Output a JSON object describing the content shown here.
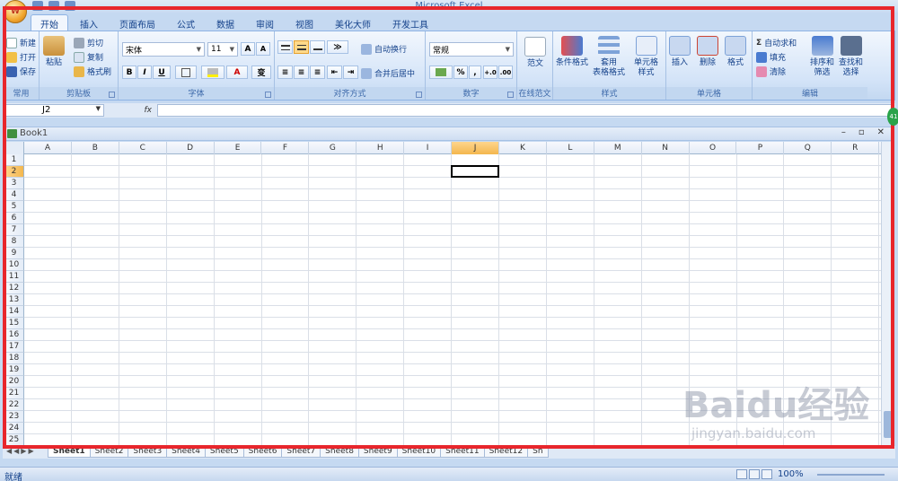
{
  "app": {
    "title": "Microsoft Excel",
    "office_logo": "W"
  },
  "ribbon_tabs": [
    "开始",
    "插入",
    "页面布局",
    "公式",
    "数据",
    "审阅",
    "视图",
    "美化大师",
    "开发工具"
  ],
  "ribbon": {
    "common": {
      "new": "新建",
      "open": "打开",
      "save": "保存",
      "label": "常用"
    },
    "clipboard": {
      "paste": "粘贴",
      "cut": "剪切",
      "copy": "复制",
      "format_painter": "格式刷",
      "label": "剪贴板"
    },
    "font": {
      "family": "宋体",
      "size": "11",
      "grow": "A",
      "shrink": "A",
      "bold": "B",
      "italic": "I",
      "underline": "U",
      "font_color": "A",
      "phonetic": "变",
      "label": "字体"
    },
    "alignment": {
      "wrap": "自动换行",
      "merge": "合并后居中",
      "label": "对齐方式"
    },
    "number": {
      "format": "常规",
      "percent": "%",
      "comma": ",",
      "label": "数字"
    },
    "template": {
      "fanwen": "范文",
      "label": "在线范文"
    },
    "styles": {
      "conditional": "条件格式",
      "table_top": "套用",
      "table_bottom": "表格格式",
      "cell_top": "单元格",
      "cell_bottom": "样式",
      "label": "样式"
    },
    "cells": {
      "insert": "插入",
      "delete": "删除",
      "format": "格式",
      "label": "单元格"
    },
    "editing": {
      "autosum": "自动求和",
      "fill": "填充",
      "clear": "清除",
      "sort_top": "排序和",
      "sort_bottom": "筛选",
      "find_top": "查找和",
      "find_bottom": "选择",
      "label": "编辑"
    }
  },
  "formula_bar": {
    "name_box": "J2",
    "fx": "fx",
    "value": ""
  },
  "workbook": {
    "name": "Book1"
  },
  "columns": [
    "A",
    "B",
    "C",
    "D",
    "E",
    "F",
    "G",
    "H",
    "I",
    "J",
    "K",
    "L",
    "M",
    "N",
    "O",
    "P",
    "Q",
    "R"
  ],
  "rows": [
    "1",
    "2",
    "3",
    "4",
    "5",
    "6",
    "7",
    "8",
    "9",
    "10",
    "11",
    "12",
    "13",
    "14",
    "15",
    "16",
    "17",
    "18",
    "19",
    "20",
    "21",
    "22",
    "23",
    "24",
    "25"
  ],
  "selected": {
    "column": "J",
    "row": "2"
  },
  "sheets": [
    "Sheet1",
    "Sheet2",
    "Sheet3",
    "Sheet4",
    "Sheet5",
    "Sheet6",
    "Sheet7",
    "Sheet8",
    "Sheet9",
    "Sheet10",
    "Sheet11",
    "Sheet12",
    "Sh"
  ],
  "status": {
    "ready": "就绪",
    "zoom": "100%"
  },
  "watermark": {
    "brand": "Baidu经验",
    "url": "jingyan.baidu.com"
  },
  "colors": {
    "frame": "#e8262c",
    "ribbon": "#dbe7f6",
    "selection_header": "#f3b74e"
  }
}
